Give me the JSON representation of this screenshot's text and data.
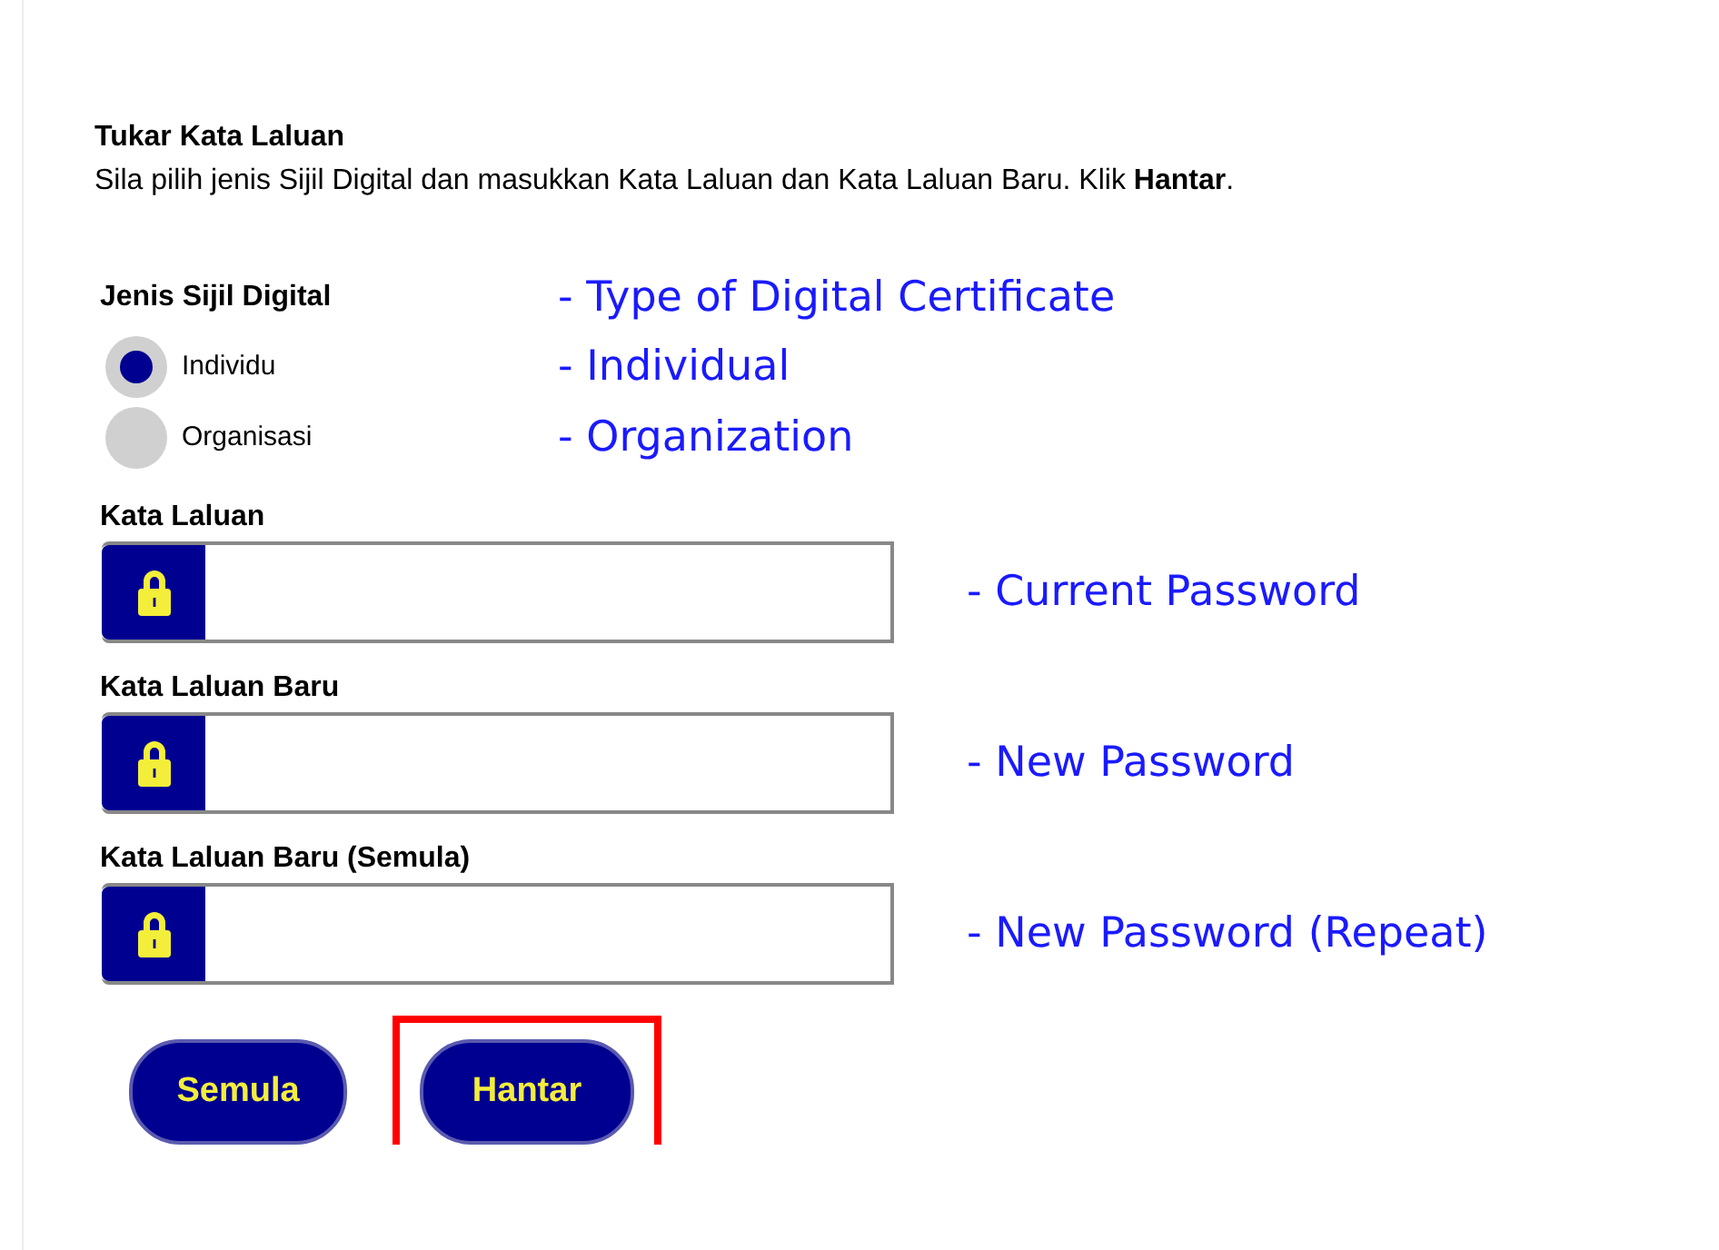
{
  "heading": "Tukar Kata Laluan",
  "instruction": "Sila pilih jenis Sijil Digital dan masukkan Kata Laluan dan Kata Laluan Baru. Klik **Hantar**.",
  "certificate_type": {
    "label": "Jenis Sijil Digital",
    "annotation": "- Type of Digital Certificate",
    "options": [
      {
        "label": "Individu",
        "selected": true,
        "annotation": "- Individual"
      },
      {
        "label": "Organisasi",
        "selected": false,
        "annotation": "- Organization"
      }
    ]
  },
  "fields": [
    {
      "label": "Kata Laluan",
      "annotation": "- Current Password"
    },
    {
      "label": "Kata Laluan Baru",
      "annotation": "- New Password"
    },
    {
      "label": "Kata Laluan Baru (Semula)",
      "annotation": "- New Password (Repeat)"
    }
  ],
  "buttons": [
    {
      "label": "Semula",
      "highlighted": false
    },
    {
      "label": "Hantar",
      "highlighted": true
    }
  ]
}
